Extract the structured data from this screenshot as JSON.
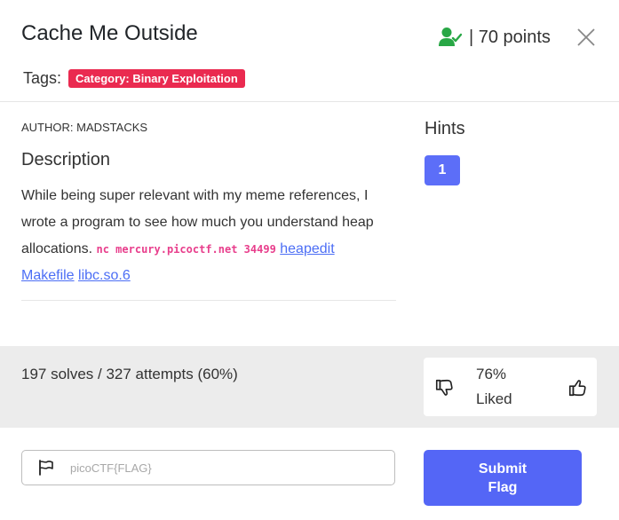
{
  "header": {
    "title": "Cache Me Outside",
    "points": "| 70 points",
    "user_icon": "user-check-icon",
    "close_icon": "close-icon"
  },
  "tags": {
    "label": "Tags:",
    "category": "Category: Binary Exploitation",
    "category_color": "#ea2a50"
  },
  "challenge": {
    "author": "AUTHOR: MADSTACKS",
    "description_heading": "Description",
    "description_text": "While being super relevant with my meme references, I wrote a program to see how much you understand heap allocations.",
    "command": "nc mercury.picoctf.net 34499",
    "links": [
      "heapedit",
      "Makefile",
      "libc.so.6"
    ]
  },
  "hints": {
    "heading": "Hints",
    "items": [
      "1"
    ],
    "color": "#5c6ef8"
  },
  "stats": {
    "solves_text": "197 solves / 327 attempts (60%)",
    "liked_percent": "76%",
    "liked_label": "Liked"
  },
  "flag_form": {
    "placeholder": "picoCTF{FLAG}",
    "value": "",
    "submit_line1": "Submit",
    "submit_line2": "Flag",
    "submit_color": "#5466f6"
  }
}
